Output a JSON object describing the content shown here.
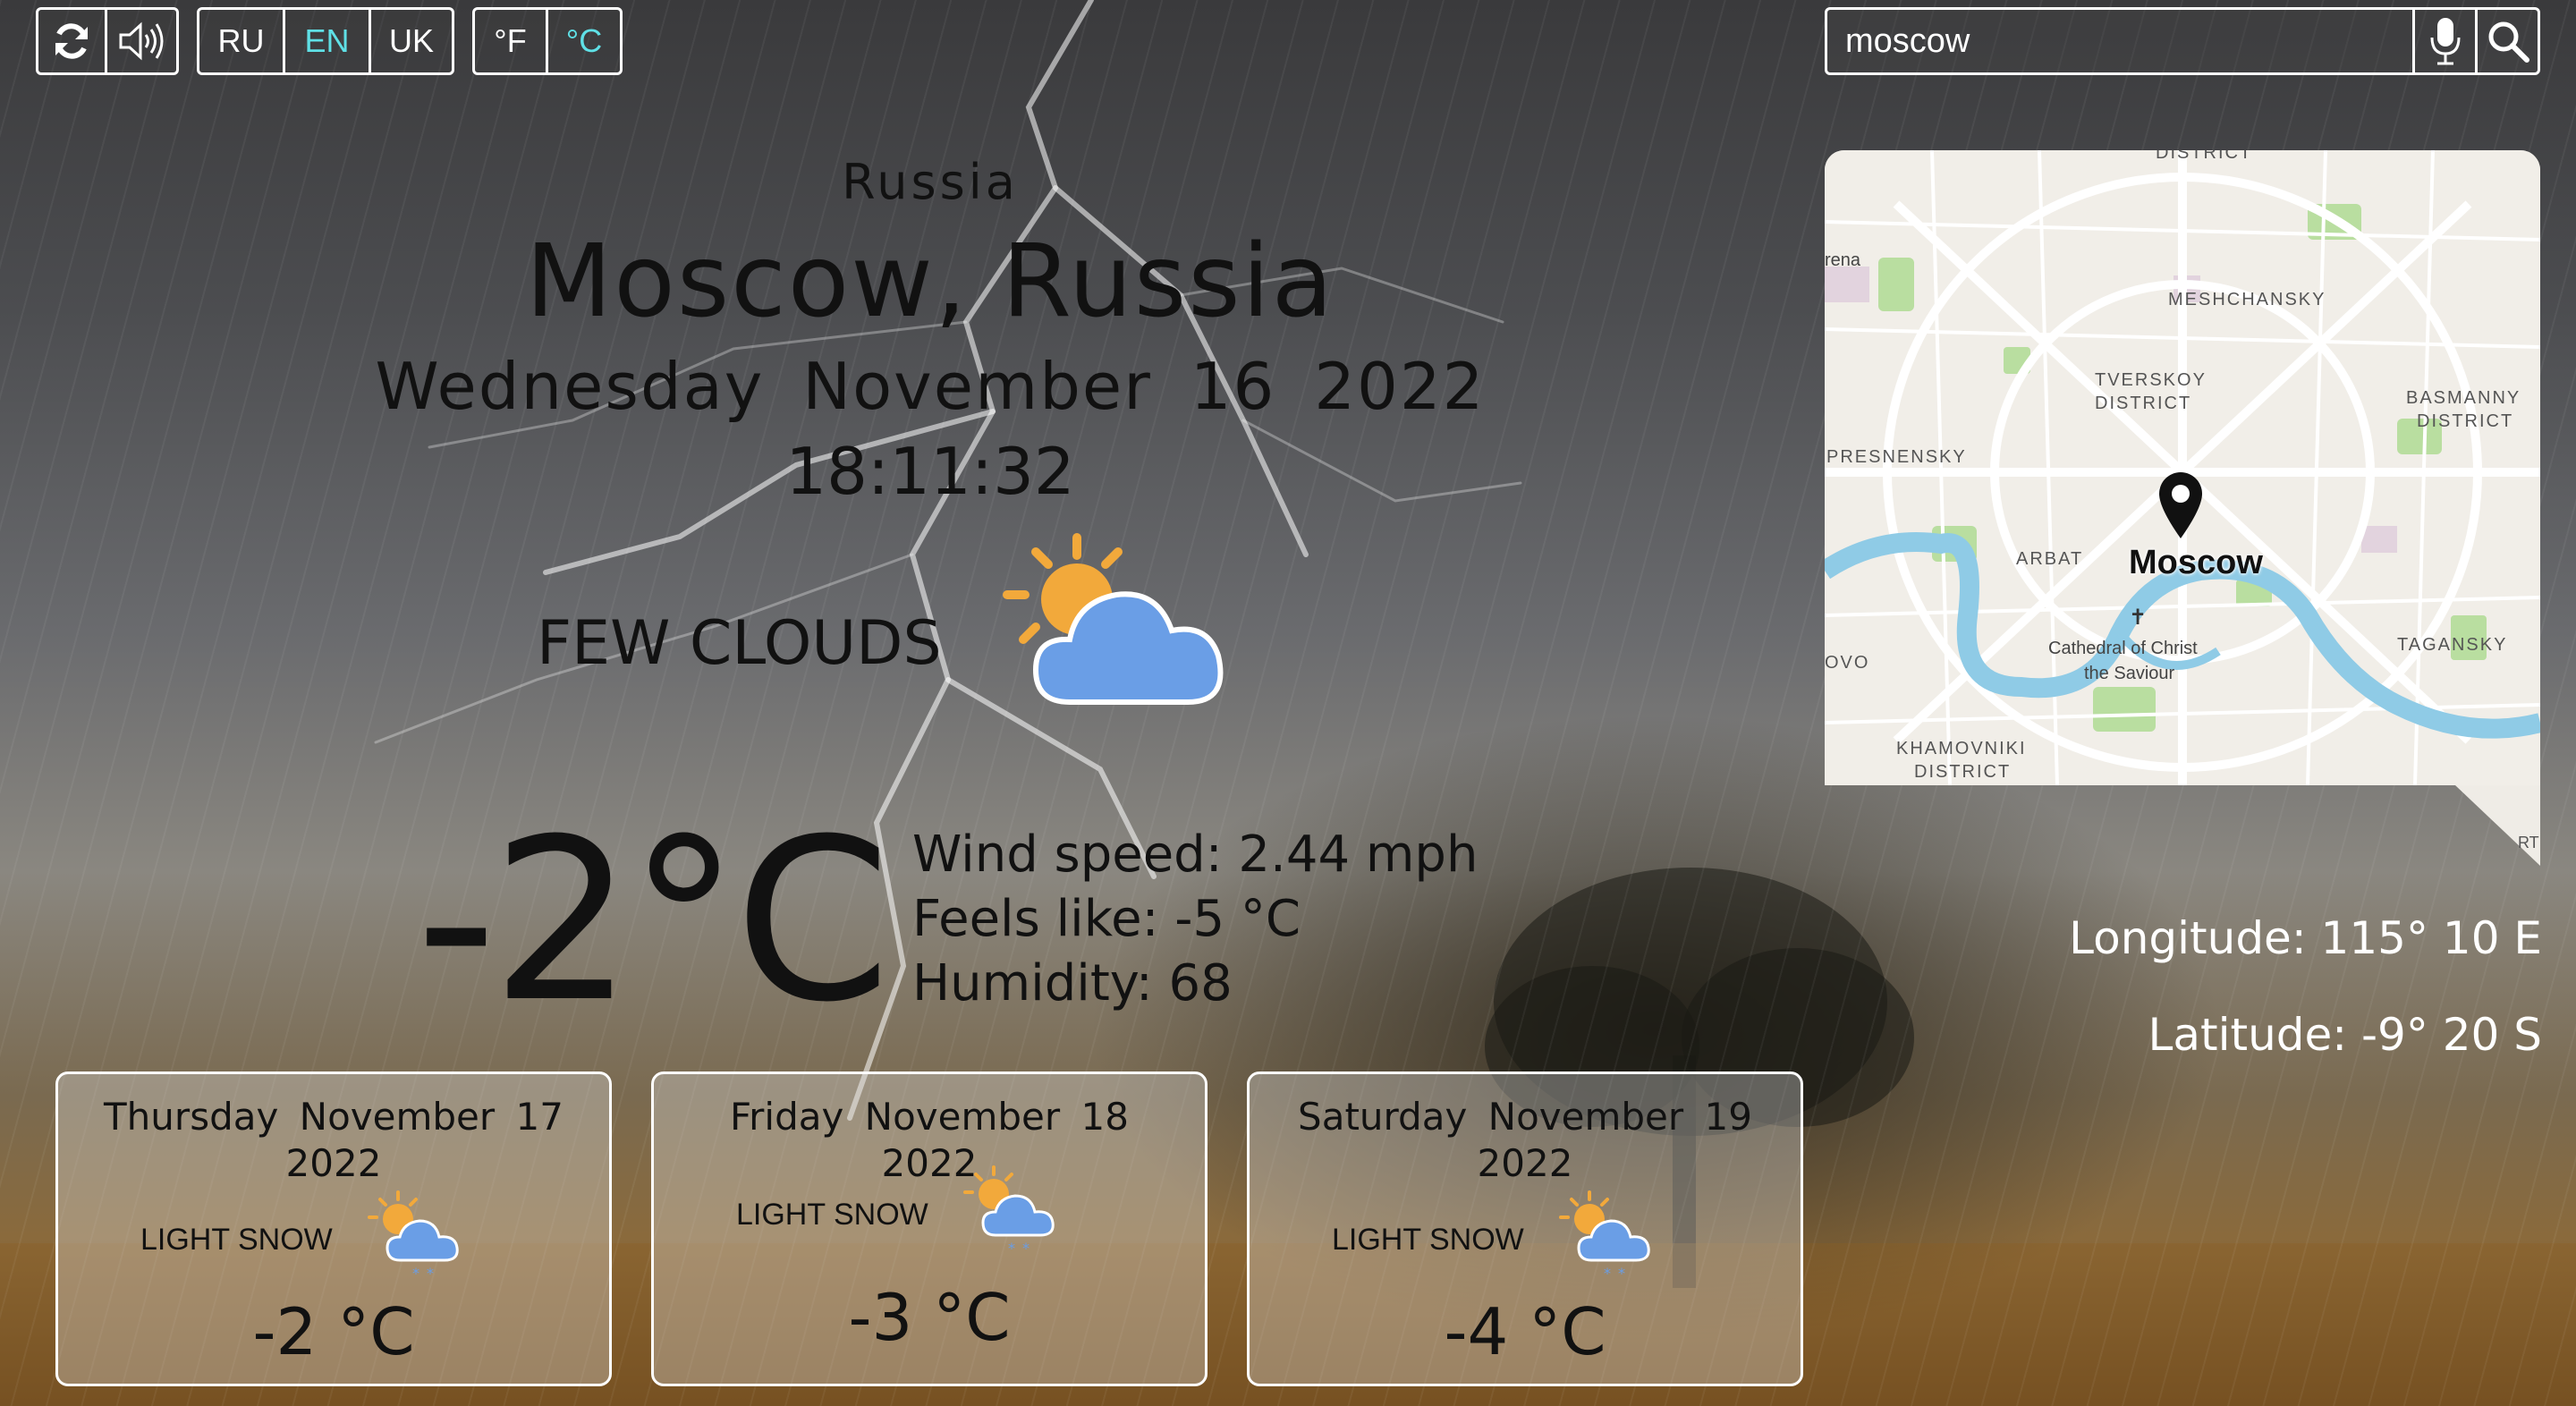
{
  "controls": {
    "refresh_icon": "refresh-icon",
    "sound_icon": "speaker-icon",
    "languages": [
      "RU",
      "EN",
      "UK"
    ],
    "active_language": "EN",
    "units": [
      "°F",
      "°C"
    ],
    "active_unit": "°C"
  },
  "search": {
    "value": "moscow",
    "mic_icon": "microphone-icon",
    "search_icon": "search-icon"
  },
  "location": {
    "country": "Russia",
    "city": "Moscow, Russia",
    "date": "Wednesday November 16 2022",
    "time": "18:11:32"
  },
  "current": {
    "description": "FEW CLOUDS",
    "icon": "sun-cloud-icon",
    "temperature": "-2°C",
    "wind": "Wind speed: 2.44 mph",
    "feels_like": "Feels like: -5 °C",
    "humidity": "Humidity: 68"
  },
  "map": {
    "city_label": "Moscow",
    "labels": {
      "district": "DISTRICT",
      "arena": "rena",
      "meshchansky": "MESHCHANSKY",
      "tverskoy": "TVERSKOY",
      "tverskoy_district": "DISTRICT",
      "basmanny": "BASMANNY",
      "basmanny_district": "DISTRICT",
      "presnensky": "PRESNENSKY",
      "arbat": "ARBAT",
      "cathedral1": "Cathedral of Christ",
      "cathedral2": "the Saviour",
      "ovo": "OVO",
      "tagansky": "TAGANSKY",
      "khamovniki": "KHAMOVNIKI",
      "khamovniki_district": "DISTRICT",
      "rt": "RT"
    }
  },
  "coordinates": {
    "longitude": "Longitude: 115° 10 E",
    "latitude": "Latitude: -9° 20 S"
  },
  "forecast": [
    {
      "date": "Thursday November 17 2022",
      "description": "LIGHT SNOW",
      "temperature": "-2 °C",
      "icon": "sun-cloud-snow-icon"
    },
    {
      "date": "Friday November 18 2022",
      "description": "LIGHT SNOW",
      "temperature": "-3 °C",
      "icon": "sun-cloud-snow-icon"
    },
    {
      "date": "Saturday November 19 2022",
      "description": "LIGHT SNOW",
      "temperature": "-4 °C",
      "icon": "sun-cloud-snow-icon"
    }
  ],
  "colors": {
    "active_accent": "#5fe0e6",
    "sun": "#f2a93b",
    "cloud": "#6a9ee6"
  }
}
